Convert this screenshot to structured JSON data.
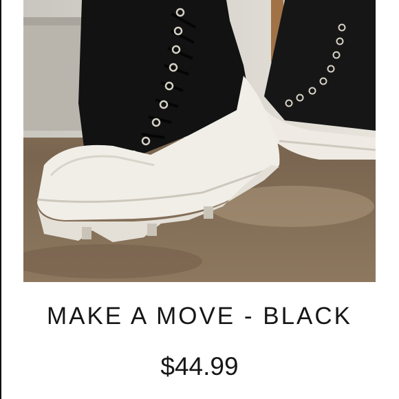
{
  "product": {
    "title": "MAKE A MOVE - BLACK",
    "price": "$44.99",
    "image_icon": "sneaker-boot-photo"
  },
  "colors": {
    "text": "#161616",
    "shoe_upper": "#121212",
    "shoe_sole": "#f1eee8",
    "floor": "#8a7660"
  }
}
